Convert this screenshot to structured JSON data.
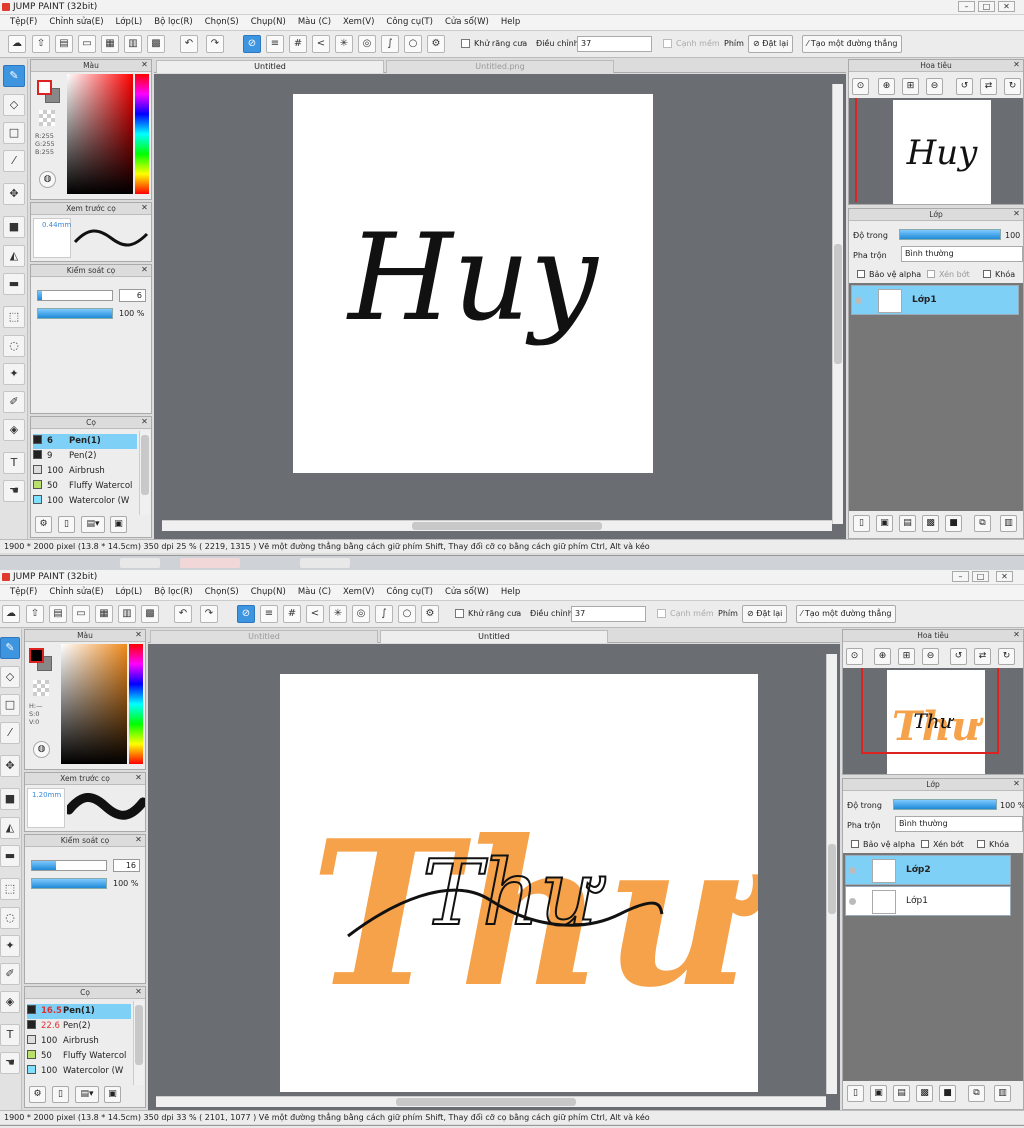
{
  "windows": [
    {
      "title": "JUMP PAINT (32bit)",
      "menu": [
        "Tệp(F)",
        "Chỉnh sửa(E)",
        "Lớp(L)",
        "Bộ lọc(R)",
        "Chọn(S)",
        "Chụp(N)",
        "Màu (C)",
        "Xem(V)",
        "Công cụ(T)",
        "Cửa sổ(W)",
        "Help"
      ],
      "toolbar": {
        "antialias_label": "Khử răng cưa",
        "adjust_label": "Điều chỉnh",
        "adjust_value": "37",
        "edge_label": "Cạnh mềm",
        "key_label": "Phím",
        "reset_label": "Đặt lại",
        "straight_label": "Tạo một đường thẳng"
      },
      "tabs": [
        "Untitled",
        "Untitled.png"
      ],
      "color_panel": {
        "title": "Màu",
        "rgb": [
          "R:255",
          "G:255",
          "B:255"
        ]
      },
      "brush_preview": {
        "title": "Xem trước cọ",
        "size": "0.44mm"
      },
      "brush_control": {
        "title": "Kiểm soát cọ",
        "size": "6",
        "opacity": "100 %",
        "size_fill": 0.05
      },
      "brushes": {
        "title": "Cọ",
        "items": [
          {
            "size": "6",
            "name": "Pen(1)",
            "color": "#222222"
          },
          {
            "size": "9",
            "name": "Pen(2)",
            "color": "#222222"
          },
          {
            "size": "100",
            "name": "Airbrush",
            "color": "#dddddd"
          },
          {
            "size": "50",
            "name": "Fluffy Watercol",
            "color": "#b8e06a"
          },
          {
            "size": "100",
            "name": "Watercolor (W",
            "color": "#7fe0ff"
          }
        ]
      },
      "navigator": {
        "title": "Hoa tiêu"
      },
      "layers": {
        "title": "Lớp",
        "opacity_label": "Độ trong",
        "opacity_value": "100",
        "blend_label": "Pha trộn",
        "blend_value": "Bình thường",
        "protect_alpha": "Bảo vệ alpha",
        "clip": "Xén bớt",
        "lock": "Khóa",
        "items": [
          "Lớp1"
        ]
      },
      "canvas_text": "Huy",
      "status": "1900 * 2000 pixel   (13.8 * 14.5cm)   350 dpi   25 %   ( 2219, 1315 )   Vẽ một đường thẳng bằng cách giữ phím Shift, Thay đổi cỡ cọ bằng cách giữ phím Ctrl, Alt và kéo"
    },
    {
      "title": "JUMP PAINT (32bit)",
      "menu": [
        "Tệp(F)",
        "Chỉnh sửa(E)",
        "Lớp(L)",
        "Bộ lọc(R)",
        "Chọn(S)",
        "Chụp(N)",
        "Màu (C)",
        "Xem(V)",
        "Công cụ(T)",
        "Cửa sổ(W)",
        "Help"
      ],
      "toolbar": {
        "antialias_label": "Khử răng cưa",
        "adjust_label": "Điều chỉnh",
        "adjust_value": "37",
        "edge_label": "Cạnh mềm",
        "key_label": "Phím",
        "reset_label": "Đặt lại",
        "straight_label": "Tạo một đường thẳng"
      },
      "tabs": [
        "Untitled",
        "Untitled"
      ],
      "color_panel": {
        "title": "Màu",
        "rgb": [
          "H:—",
          "S:0",
          "V:0"
        ]
      },
      "brush_preview": {
        "title": "Xem trước cọ",
        "size": "1.20mm"
      },
      "brush_control": {
        "title": "Kiểm soát cọ",
        "size": "16",
        "opacity": "100 %",
        "size_fill": 0.33
      },
      "brushes": {
        "title": "Cọ",
        "items": [
          {
            "size": "16.5",
            "name": "Pen(1)",
            "color": "#222222"
          },
          {
            "size": "22.6",
            "name": "Pen(2)",
            "color": "#222222"
          },
          {
            "size": "100",
            "name": "Airbrush",
            "color": "#dddddd"
          },
          {
            "size": "50",
            "name": "Fluffy Watercol",
            "color": "#b8e06a"
          },
          {
            "size": "100",
            "name": "Watercolor (W",
            "color": "#7fe0ff"
          }
        ]
      },
      "navigator": {
        "title": "Hoa tiêu"
      },
      "layers": {
        "title": "Lớp",
        "opacity_label": "Độ trong",
        "opacity_value": "100 %",
        "blend_label": "Pha trộn",
        "blend_value": "Bình thường",
        "protect_alpha": "Bảo vệ alpha",
        "clip": "Xén bớt",
        "lock": "Khóa",
        "items": [
          "Lớp2",
          "Lớp1"
        ]
      },
      "canvas_text": "Thư",
      "status": "1900 * 2000 pixel   (13.8 * 14.5cm)   350 dpi   33 %   ( 2101, 1077 )   Vẽ một đường thẳng bằng cách giữ phím Shift, Thay đổi cỡ cọ bằng cách giữ phím Ctrl, Alt và kéo"
    }
  ],
  "colors": {
    "accent": "#3d95e0",
    "orange": "#f5a24a",
    "ink": "#111111"
  }
}
